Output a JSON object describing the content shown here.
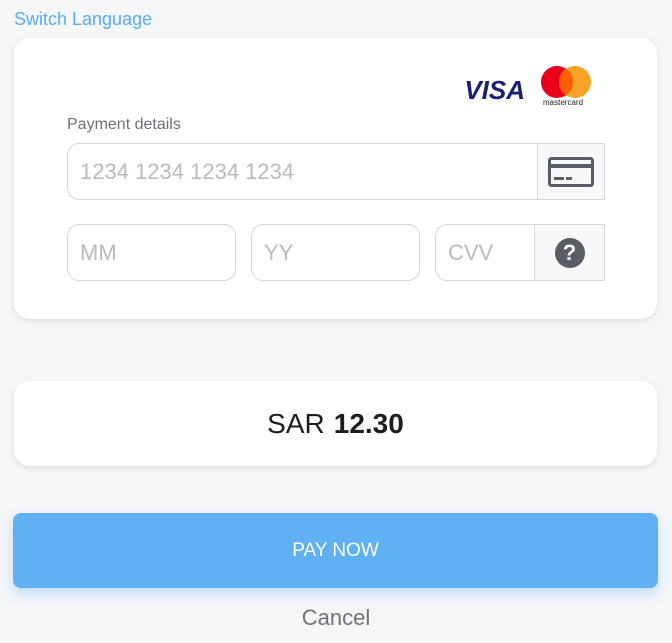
{
  "header": {
    "switch_language": "Switch Language"
  },
  "payment_form": {
    "brands": {
      "visa": "VISA",
      "mastercard": "mastercard"
    },
    "label": "Payment details",
    "card_number_placeholder": "1234 1234 1234 1234",
    "month_placeholder": "MM",
    "year_placeholder": "YY",
    "cvv_placeholder": "CVV",
    "help_symbol": "?",
    "icons": {
      "card": "credit-card-icon",
      "help": "question-icon"
    }
  },
  "amount": {
    "currency": "SAR",
    "value": "12.30"
  },
  "actions": {
    "pay_label": "PAY NOW",
    "cancel_label": "Cancel"
  },
  "colors": {
    "accent": "#60b0f4",
    "link": "#5aacf2",
    "background": "#f5f6f8"
  }
}
